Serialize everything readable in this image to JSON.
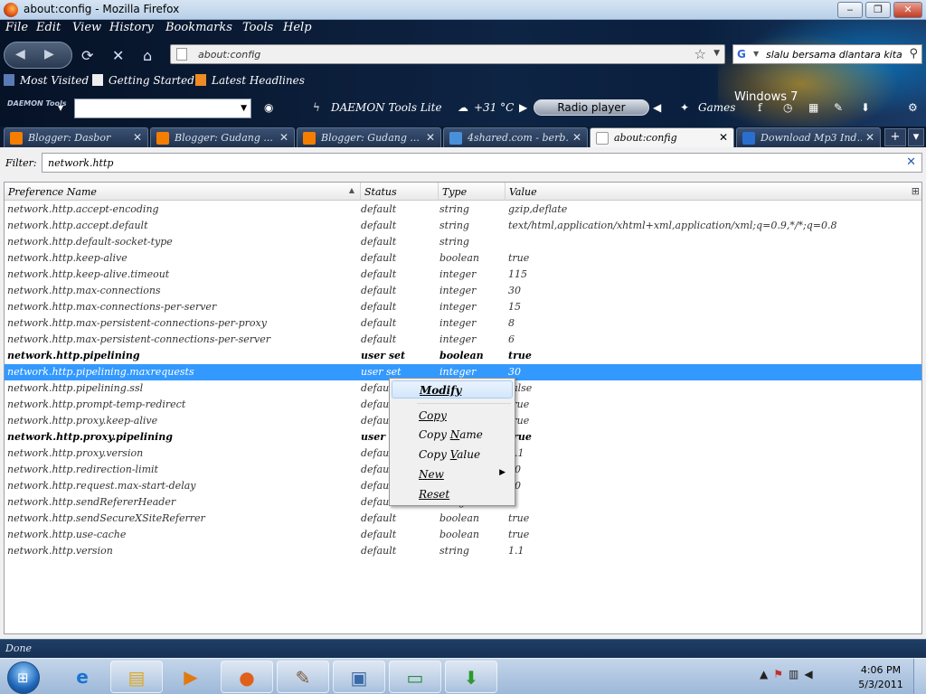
{
  "window": {
    "title": "about:config - Mozilla Firefox",
    "minimize": "‒",
    "maximize": "❐",
    "close": "✕"
  },
  "menu": [
    "File",
    "Edit",
    "View",
    "History",
    "Bookmarks",
    "Tools",
    "Help"
  ],
  "nav": {
    "url": "about:config",
    "search_query": "slalu bersama dlantara kita"
  },
  "bookmarks": [
    "Most Visited",
    "Getting Started",
    "Latest Headlines"
  ],
  "toolbar2": {
    "daemon_logo": "DAEMON Tools",
    "daemon_label": "DAEMON Tools Lite",
    "temperature": "+31 °C",
    "radio": "Radio player",
    "games": "Games"
  },
  "desktop_brand": "Windows 7",
  "tabs": [
    {
      "label": "Blogger: Dasbor",
      "active": false
    },
    {
      "label": "Blogger: Gudang ...",
      "active": false
    },
    {
      "label": "Blogger: Gudang ...",
      "active": false
    },
    {
      "label": "4shared.com - berb...",
      "active": false
    },
    {
      "label": "about:config",
      "active": true
    },
    {
      "label": "Download Mp3 Ind...",
      "active": false
    }
  ],
  "tab_buttons": {
    "new": "+",
    "list": "▾"
  },
  "filter": {
    "label": "Filter:",
    "value": "network.http"
  },
  "columns": [
    "Preference Name",
    "Status",
    "Type",
    "Value"
  ],
  "rows": [
    {
      "name": "network.http.accept-encoding",
      "status": "default",
      "type": "string",
      "value": "gzip,deflate",
      "bold": false
    },
    {
      "name": "network.http.accept.default",
      "status": "default",
      "type": "string",
      "value": "text/html,application/xhtml+xml,application/xml;q=0.9,*/*;q=0.8",
      "bold": false
    },
    {
      "name": "network.http.default-socket-type",
      "status": "default",
      "type": "string",
      "value": "",
      "bold": false
    },
    {
      "name": "network.http.keep-alive",
      "status": "default",
      "type": "boolean",
      "value": "true",
      "bold": false
    },
    {
      "name": "network.http.keep-alive.timeout",
      "status": "default",
      "type": "integer",
      "value": "115",
      "bold": false
    },
    {
      "name": "network.http.max-connections",
      "status": "default",
      "type": "integer",
      "value": "30",
      "bold": false
    },
    {
      "name": "network.http.max-connections-per-server",
      "status": "default",
      "type": "integer",
      "value": "15",
      "bold": false
    },
    {
      "name": "network.http.max-persistent-connections-per-proxy",
      "status": "default",
      "type": "integer",
      "value": "8",
      "bold": false
    },
    {
      "name": "network.http.max-persistent-connections-per-server",
      "status": "default",
      "type": "integer",
      "value": "6",
      "bold": false
    },
    {
      "name": "network.http.pipelining",
      "status": "user set",
      "type": "boolean",
      "value": "true",
      "bold": true
    },
    {
      "name": "network.http.pipelining.maxrequests",
      "status": "user set",
      "type": "integer",
      "value": "30",
      "bold": false,
      "selected": true
    },
    {
      "name": "network.http.pipelining.ssl",
      "status": "default",
      "type": "boolean",
      "value": "false",
      "bold": false
    },
    {
      "name": "network.http.prompt-temp-redirect",
      "status": "default",
      "type": "boolean",
      "value": "true",
      "bold": false
    },
    {
      "name": "network.http.proxy.keep-alive",
      "status": "default",
      "type": "boolean",
      "value": "true",
      "bold": false
    },
    {
      "name": "network.http.proxy.pipelining",
      "status": "user set",
      "type": "boolean",
      "value": "true",
      "bold": true
    },
    {
      "name": "network.http.proxy.version",
      "status": "default",
      "type": "string",
      "value": "1.1",
      "bold": false
    },
    {
      "name": "network.http.redirection-limit",
      "status": "default",
      "type": "integer",
      "value": "20",
      "bold": false
    },
    {
      "name": "network.http.request.max-start-delay",
      "status": "default",
      "type": "integer",
      "value": "10",
      "bold": false
    },
    {
      "name": "network.http.sendRefererHeader",
      "status": "default",
      "type": "integer",
      "value": "2",
      "bold": false
    },
    {
      "name": "network.http.sendSecureXSiteReferrer",
      "status": "default",
      "type": "boolean",
      "value": "true",
      "bold": false
    },
    {
      "name": "network.http.use-cache",
      "status": "default",
      "type": "boolean",
      "value": "true",
      "bold": false
    },
    {
      "name": "network.http.version",
      "status": "default",
      "type": "string",
      "value": "1.1",
      "bold": false
    }
  ],
  "context_menu": {
    "modify": "Modify",
    "copy": "Copy",
    "copy_name_pre": "Copy ",
    "copy_name_u": "N",
    "copy_name_post": "ame",
    "copy_value_pre": "Copy ",
    "copy_value_u": "V",
    "copy_value_post": "alue",
    "new": "New",
    "reset": "Reset"
  },
  "status_text": "Done",
  "clock": {
    "time": "4:06 PM",
    "date": "5/3/2011"
  },
  "colors": {
    "selection": "#3399ff",
    "chrome_dark": "#0b1e36"
  }
}
